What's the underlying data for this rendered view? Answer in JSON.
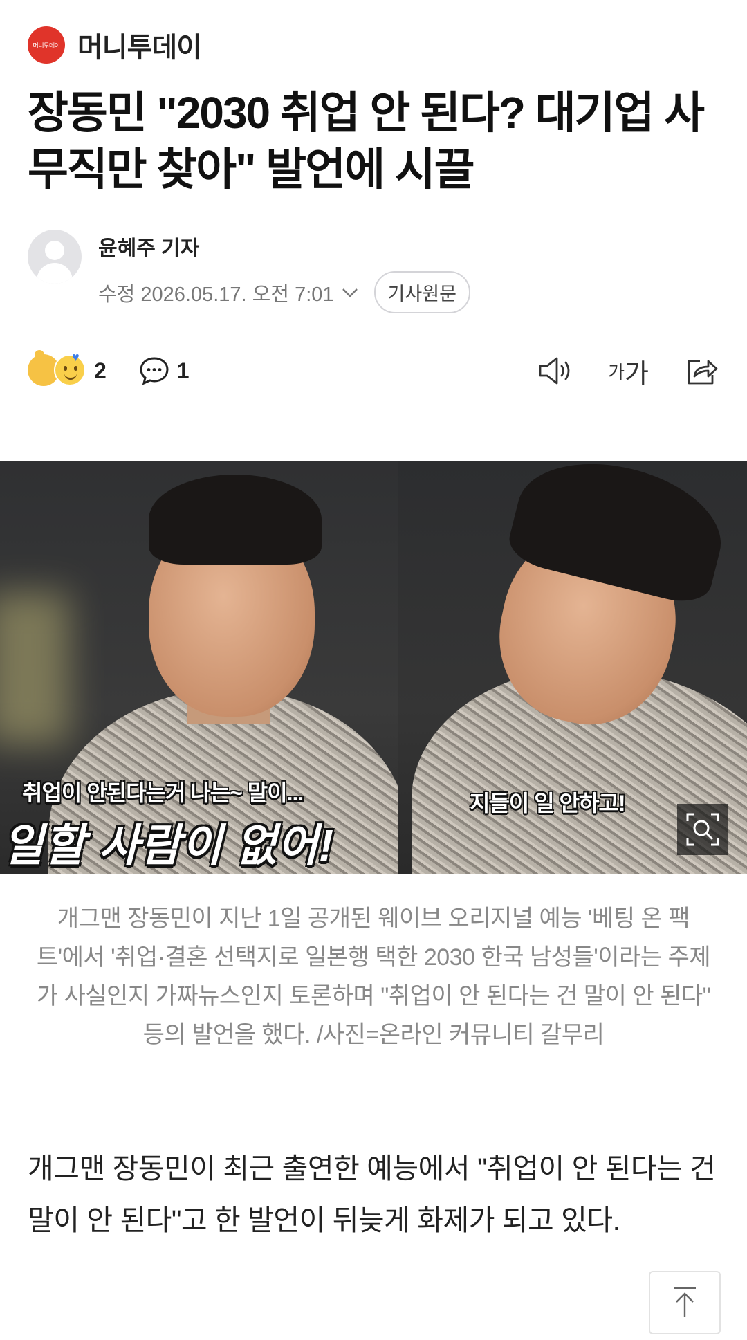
{
  "brand": {
    "logo_text": "머니투데이",
    "name": "머니투데이"
  },
  "article": {
    "headline": "장동민 \"2030 취업 안 된다? 대기업 사무직만 찾아\" 발언에 시끌",
    "reporter": "윤혜주 기자",
    "updated": "수정 2026.05.17. 오전 7:01",
    "original_button": "기사원문",
    "body": "개그맨 장동민이 최근 출연한 예능에서 \"취업이 안 된다는 건 말이 안 된다\"고 한 발언이 뒤늦게 화제가 되고 있다."
  },
  "actions": {
    "reaction_count": "2",
    "comment_count": "1",
    "font_size_small": "가",
    "font_size_big": "가"
  },
  "photo": {
    "left_caption_small": "취업이 안된다는거 나는~ 말이...",
    "left_caption_big": "일할 사람이 없어!",
    "right_caption": "지들이 일 안하고!",
    "caption": "개그맨 장동민이 지난 1일 공개된 웨이브 오리지널 예능 '베팅 온 팩트'에서 '취업·결혼 선택지로 일본행 택한 2030 한국 남성들'이라는 주제가 사실인지 가짜뉴스인지 토론하며 \"취업이 안 된다는 건 말이 안 된다\" 등의 발언을 했다. /사진=온라인 커뮤니티 갈무리"
  },
  "icons": {
    "chevron": "chevron-down-icon",
    "comment": "speech-bubble-icon",
    "speaker": "speaker-icon",
    "share": "share-icon",
    "zoom": "zoom-icon",
    "top": "arrow-up-icon"
  },
  "colors": {
    "brand_red": "#e0342a",
    "meta_gray": "#777777",
    "caption_gray": "#888888"
  }
}
